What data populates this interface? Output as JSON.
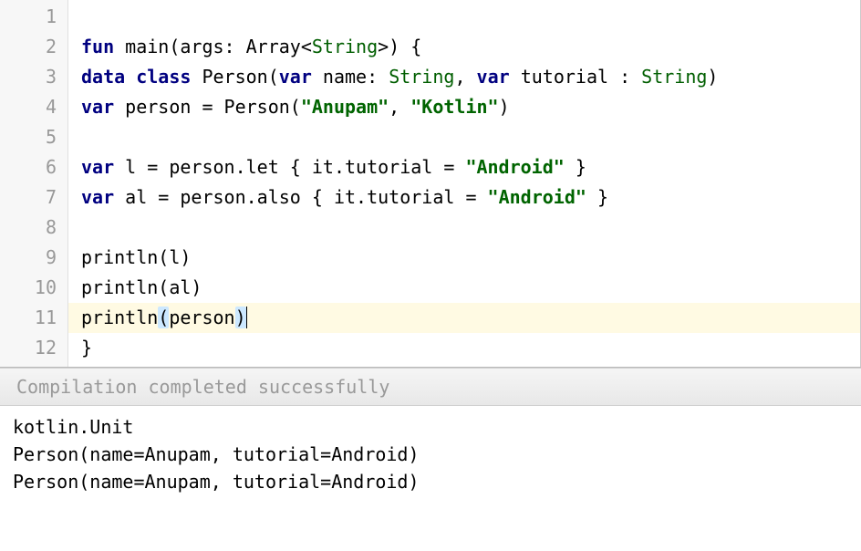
{
  "editor": {
    "highlighted_line": 11,
    "lines": [
      {
        "num": "1",
        "tokens": []
      },
      {
        "num": "2",
        "tokens": [
          {
            "cls": "kw",
            "t": "fun"
          },
          {
            "cls": "",
            "t": " main(args: Array<"
          },
          {
            "cls": "type",
            "t": "String"
          },
          {
            "cls": "",
            "t": ">) {"
          }
        ]
      },
      {
        "num": "3",
        "tokens": [
          {
            "cls": "kw",
            "t": "data"
          },
          {
            "cls": "",
            "t": " "
          },
          {
            "cls": "kw",
            "t": "class"
          },
          {
            "cls": "",
            "t": " Person("
          },
          {
            "cls": "kw",
            "t": "var"
          },
          {
            "cls": "",
            "t": " name: "
          },
          {
            "cls": "type",
            "t": "String"
          },
          {
            "cls": "",
            "t": ", "
          },
          {
            "cls": "kw",
            "t": "var"
          },
          {
            "cls": "",
            "t": " tutorial : "
          },
          {
            "cls": "type",
            "t": "String"
          },
          {
            "cls": "",
            "t": ")"
          }
        ]
      },
      {
        "num": "4",
        "tokens": [
          {
            "cls": "kw",
            "t": "var"
          },
          {
            "cls": "",
            "t": " person = Person("
          },
          {
            "cls": "str",
            "t": "\"Anupam\""
          },
          {
            "cls": "",
            "t": ", "
          },
          {
            "cls": "str",
            "t": "\"Kotlin\""
          },
          {
            "cls": "",
            "t": ")"
          }
        ]
      },
      {
        "num": "5",
        "tokens": []
      },
      {
        "num": "6",
        "tokens": [
          {
            "cls": "kw",
            "t": "var"
          },
          {
            "cls": "",
            "t": " l = person.let { it.tutorial = "
          },
          {
            "cls": "str",
            "t": "\"Android\""
          },
          {
            "cls": "",
            "t": " }"
          }
        ]
      },
      {
        "num": "7",
        "tokens": [
          {
            "cls": "kw",
            "t": "var"
          },
          {
            "cls": "",
            "t": " al = person.also { it.tutorial = "
          },
          {
            "cls": "str",
            "t": "\"Android\""
          },
          {
            "cls": "",
            "t": " }"
          }
        ]
      },
      {
        "num": "8",
        "tokens": []
      },
      {
        "num": "9",
        "tokens": [
          {
            "cls": "",
            "t": "println(l)"
          }
        ]
      },
      {
        "num": "10",
        "tokens": [
          {
            "cls": "",
            "t": "println(al)"
          }
        ]
      },
      {
        "num": "11",
        "tokens": [
          {
            "cls": "",
            "t": "println"
          },
          {
            "cls": "bracket-match",
            "t": "("
          },
          {
            "cls": "",
            "t": "person"
          },
          {
            "cls": "bracket-match",
            "t": ")"
          }
        ],
        "caret": true
      },
      {
        "num": "12",
        "tokens": [
          {
            "cls": "",
            "t": "}"
          }
        ]
      }
    ]
  },
  "status": {
    "message": "Compilation completed successfully"
  },
  "output": {
    "lines": [
      "kotlin.Unit",
      "Person(name=Anupam, tutorial=Android)",
      "Person(name=Anupam, tutorial=Android)"
    ]
  }
}
